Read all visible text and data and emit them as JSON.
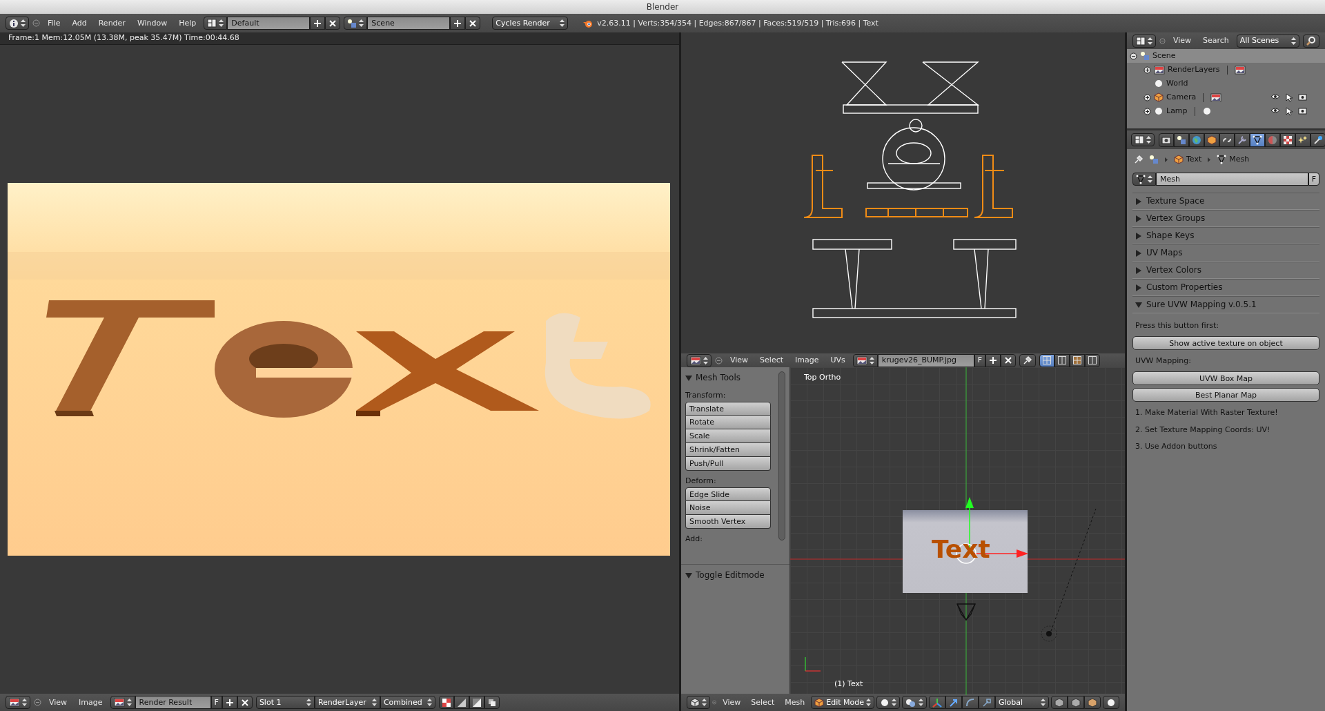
{
  "window": {
    "title": "Blender"
  },
  "info_header": {
    "menus": [
      "File",
      "Add",
      "Render",
      "Window",
      "Help"
    ],
    "layout": "Default",
    "scene": "Scene",
    "engine": "Cycles Render",
    "stats": "v2.63.11 | Verts:354/354 | Edges:867/867 | Faces:519/519 | Tris:696 | Text"
  },
  "image_editor": {
    "render_info": "Frame:1 Mem:12.05M (13.38M, peak 35.47M) Time:00:44.68",
    "menus": [
      "View",
      "Image"
    ],
    "image": "Render Result",
    "fake_user": "F",
    "slot": "Slot 1",
    "layer": "RenderLayer",
    "pass": "Combined"
  },
  "uv_editor_header": {
    "menus": [
      "View",
      "Select",
      "Image",
      "UVs"
    ],
    "image": "krugev26_BUMP.jpg",
    "fake_user": "F"
  },
  "tool_shelf": {
    "panels": [
      {
        "title": "Mesh Tools",
        "expanded": true,
        "groups": [
          {
            "label": "Transform:",
            "buttons": [
              "Translate",
              "Rotate",
              "Scale",
              "Shrink/Fatten",
              "Push/Pull"
            ]
          },
          {
            "label": "Deform:",
            "buttons": [
              "Edge Slide",
              "Noise",
              "Smooth Vertex"
            ]
          },
          {
            "label": "Add:"
          }
        ]
      },
      {
        "title": "Toggle Editmode",
        "expanded": true
      }
    ]
  },
  "viewport": {
    "view_name": "Top Ortho",
    "object_text": "Text",
    "object_name": "(1) Text"
  },
  "viewport_header": {
    "menus": [
      "View",
      "Select",
      "Mesh"
    ],
    "mode": "Edit Mode",
    "orientation": "Global"
  },
  "outliner": {
    "menus": [
      "View",
      "Search"
    ],
    "filter": "All Scenes",
    "tree": [
      {
        "name": "Scene",
        "kind": "scene",
        "expanded": true,
        "selected": true,
        "children": [
          {
            "name": "RenderLayers",
            "kind": "layers",
            "expanded": false,
            "selected": false
          },
          {
            "name": "World",
            "kind": "world",
            "selected": false
          },
          {
            "name": "Camera",
            "kind": "camera",
            "expanded": false,
            "selected": false
          },
          {
            "name": "Lamp",
            "kind": "lamp",
            "expanded": false,
            "selected": false
          }
        ]
      }
    ]
  },
  "properties": {
    "tabs": [
      {
        "kind": "render",
        "selected": false
      },
      {
        "kind": "scene",
        "selected": false
      },
      {
        "kind": "world",
        "selected": false
      },
      {
        "kind": "object",
        "selected": false
      },
      {
        "kind": "constraints",
        "selected": false
      },
      {
        "kind": "modifiers",
        "selected": false
      },
      {
        "kind": "data",
        "selected": true
      },
      {
        "kind": "material",
        "selected": false
      },
      {
        "kind": "texture",
        "selected": false
      },
      {
        "kind": "particles",
        "selected": false
      },
      {
        "kind": "physics",
        "selected": false
      }
    ],
    "breadcrumb": [
      "Text",
      "Mesh"
    ],
    "datablock": "Mesh",
    "fake_user": "F",
    "panels": [
      {
        "title": "Texture Space",
        "expanded": false
      },
      {
        "title": "Vertex Groups",
        "expanded": false
      },
      {
        "title": "Shape Keys",
        "expanded": false
      },
      {
        "title": "UV Maps",
        "expanded": false
      },
      {
        "title": "Vertex Colors",
        "expanded": false
      },
      {
        "title": "Custom Properties",
        "expanded": false
      },
      {
        "title": "Sure UVW Mapping v.0.5.1",
        "expanded": true,
        "content": [
          {
            "kind": "label",
            "text": "Press this button first:"
          },
          {
            "kind": "button",
            "text": "Show active texture on object"
          },
          {
            "kind": "label",
            "text": "UVW Mapping:"
          },
          {
            "kind": "button",
            "text": "UVW Box Map"
          },
          {
            "kind": "button",
            "text": "Best Planar Map"
          },
          {
            "kind": "label",
            "text": "1. Make Material With Raster Texture!"
          },
          {
            "kind": "label",
            "text": "2. Set Texture Mapping Coords: UV!"
          },
          {
            "kind": "label",
            "text": "3. Use Addon buttons"
          }
        ]
      }
    ]
  }
}
